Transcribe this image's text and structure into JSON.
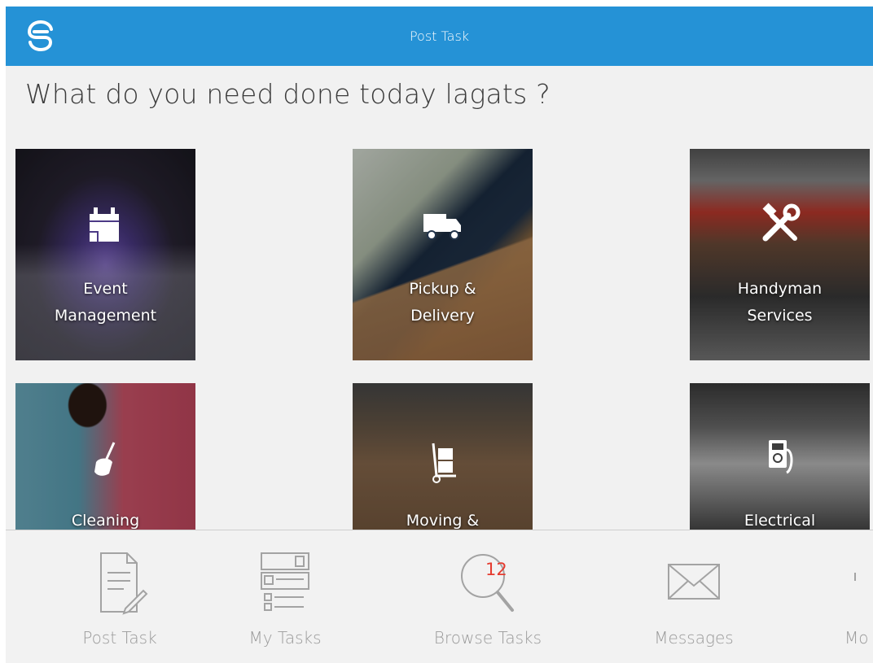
{
  "header": {
    "title": "Post Task",
    "brand_color": "#2592d6"
  },
  "prompt": {
    "text": "What do you need done today lagats ?"
  },
  "categories": [
    {
      "label_line1": "Event",
      "label_line2": "Management",
      "icon": "calendar-icon"
    },
    {
      "label_line1": "Pickup &",
      "label_line2": "Delivery",
      "icon": "truck-icon"
    },
    {
      "label_line1": "Handyman",
      "label_line2": "Services",
      "icon": "tools-icon"
    },
    {
      "label_line1": "Cleaning",
      "label_line2": "",
      "icon": "broom-icon"
    },
    {
      "label_line1": "Moving &",
      "label_line2": "",
      "icon": "hand-truck-icon"
    },
    {
      "label_line1": "Electrical",
      "label_line2": "",
      "icon": "multimeter-icon"
    }
  ],
  "tabbar": {
    "items": [
      {
        "label": "Post Task",
        "icon": "document-pencil-icon"
      },
      {
        "label": "My Tasks",
        "icon": "task-list-icon"
      },
      {
        "label": "Browse Tasks",
        "icon": "magnifier-icon",
        "badge": "12"
      },
      {
        "label": "Messages",
        "icon": "envelope-icon"
      },
      {
        "label": "Mo",
        "icon": "more-icon"
      }
    ],
    "badge_color": "#e53b2f"
  }
}
